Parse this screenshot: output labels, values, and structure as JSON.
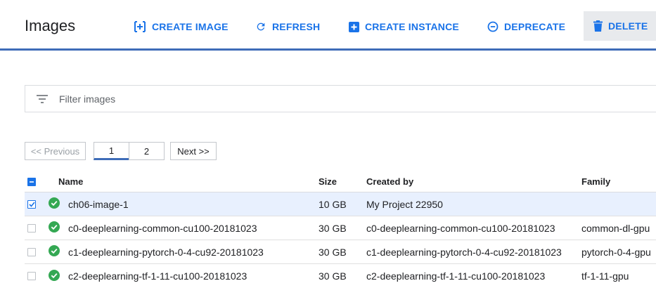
{
  "header": {
    "title": "Images",
    "buttons": {
      "create_image": "CREATE IMAGE",
      "refresh": "REFRESH",
      "create_instance": "CREATE INSTANCE",
      "deprecate": "DEPRECATE",
      "delete": "DELETE"
    }
  },
  "filter": {
    "placeholder": "Filter images",
    "value": ""
  },
  "pagination": {
    "previous": "<< Previous",
    "pages": [
      "1",
      "2"
    ],
    "current_page": "1",
    "next": "Next >>"
  },
  "table": {
    "columns": [
      "Name",
      "Size",
      "Created by",
      "Family"
    ],
    "rows": [
      {
        "selected": true,
        "status": "ok",
        "name": "ch06-image-1",
        "size": "10 GB",
        "created_by": "My Project 22950",
        "family": ""
      },
      {
        "selected": false,
        "status": "ok",
        "name": "c0-deeplearning-common-cu100-20181023",
        "size": "30 GB",
        "created_by": "c0-deeplearning-common-cu100-20181023",
        "family": "common-dl-gpu"
      },
      {
        "selected": false,
        "status": "ok",
        "name": "c1-deeplearning-pytorch-0-4-cu92-20181023",
        "size": "30 GB",
        "created_by": "c1-deeplearning-pytorch-0-4-cu92-20181023",
        "family": "pytorch-0-4-gpu"
      },
      {
        "selected": false,
        "status": "ok",
        "name": "c2-deeplearning-tf-1-11-cu100-20181023",
        "size": "30 GB",
        "created_by": "c2-deeplearning-tf-1-11-cu100-20181023",
        "family": "tf-1-11-gpu"
      }
    ]
  },
  "icons": {
    "create_image": "add-box-icon",
    "refresh": "refresh-icon",
    "create_instance": "add-instance-icon",
    "deprecate": "minus-circle-icon",
    "delete": "trash-icon",
    "filter": "filter-list-icon",
    "status": "check-circle-icon"
  },
  "colors": {
    "accent": "#1a73e8",
    "toolbar_border": "#3e6cb8",
    "status_ok": "#34a853",
    "selected_row": "#e8f0fe"
  }
}
